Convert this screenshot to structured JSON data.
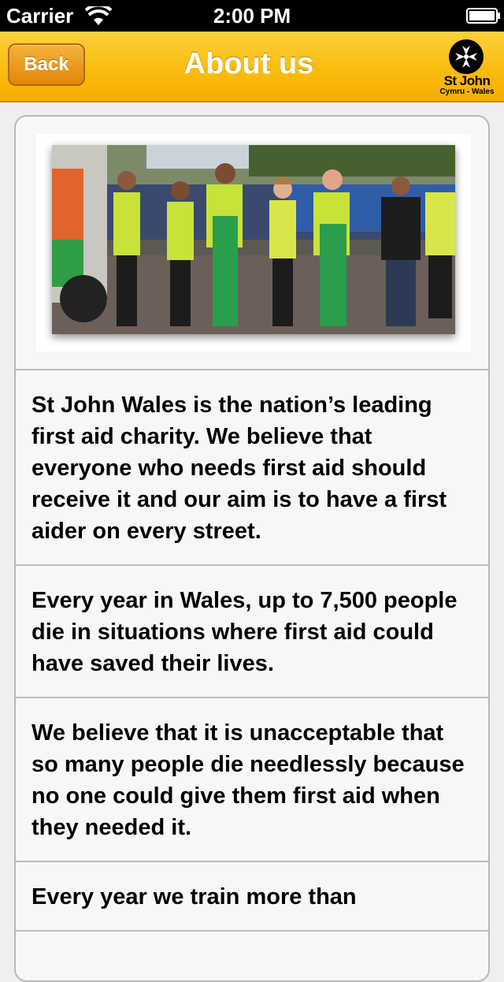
{
  "status_bar": {
    "carrier": "Carrier",
    "time": "2:00 PM"
  },
  "nav": {
    "back_label": "Back",
    "title": "About us",
    "logo_text": "St John",
    "logo_subtitle": "Cymru - Wales"
  },
  "colors": {
    "nav_yellow": "#f9bd10",
    "back_orange": "#e2860a"
  },
  "photo_alt": "",
  "paragraphs": [
    "St John Wales is the nation’s leading first aid charity. We believe that everyone who needs first aid should receive it and our aim is to have a first aider on every street.",
    "Every year in Wales, up to 7,500 people die in situations where first aid could have saved their lives.",
    "We believe that it is unacceptable that so many people die needlessly because no one could give them first aid when they needed it.",
    "Every year we train more than"
  ]
}
